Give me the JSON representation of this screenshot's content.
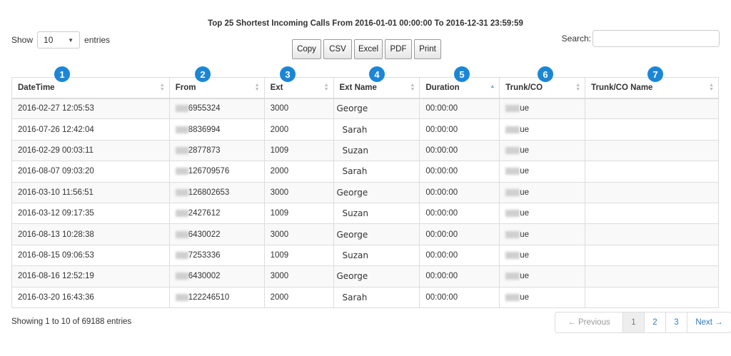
{
  "title": "Top 25 Shortest Incoming Calls From 2016-01-01 00:00:00 To 2016-12-31 23:59:59",
  "length": {
    "show_label": "Show",
    "value": "10",
    "entries_label": "entries"
  },
  "buttons": [
    "Copy",
    "CSV",
    "Excel",
    "PDF",
    "Print"
  ],
  "search": {
    "label": "Search:",
    "value": ""
  },
  "columns": [
    "DateTime",
    "From",
    "Ext",
    "Ext Name",
    "Duration",
    "Trunk/CO",
    "Trunk/CO Name"
  ],
  "badges": [
    "1",
    "2",
    "3",
    "4",
    "5",
    "6",
    "7"
  ],
  "rows": [
    {
      "datetime": "2016-02-27 12:05:53",
      "from": "6955324",
      "ext": "3000",
      "ext_name": "George",
      "duration": "00:00:00",
      "trunk": "ue",
      "trunk_name": ""
    },
    {
      "datetime": "2016-07-26 12:42:04",
      "from": "8836994",
      "ext": "2000",
      "ext_name": "Sarah",
      "duration": "00:00:00",
      "trunk": "ue",
      "trunk_name": ""
    },
    {
      "datetime": "2016-02-29 00:03:11",
      "from": "2877873",
      "ext": "1009",
      "ext_name": "Suzan",
      "duration": "00:00:00",
      "trunk": "ue",
      "trunk_name": ""
    },
    {
      "datetime": "2016-08-07 09:03:20",
      "from": "126709576",
      "ext": "2000",
      "ext_name": "Sarah",
      "duration": "00:00:00",
      "trunk": "ue",
      "trunk_name": ""
    },
    {
      "datetime": "2016-03-10 11:56:51",
      "from": "126802653",
      "ext": "3000",
      "ext_name": "George",
      "duration": "00:00:00",
      "trunk": "ue",
      "trunk_name": ""
    },
    {
      "datetime": "2016-03-12 09:17:35",
      "from": "2427612",
      "ext": "1009",
      "ext_name": "Suzan",
      "duration": "00:00:00",
      "trunk": "ue",
      "trunk_name": ""
    },
    {
      "datetime": "2016-08-13 10:28:38",
      "from": "6430022",
      "ext": "3000",
      "ext_name": "George",
      "duration": "00:00:00",
      "trunk": "ue",
      "trunk_name": ""
    },
    {
      "datetime": "2016-08-15 09:06:53",
      "from": "7253336",
      "ext": "1009",
      "ext_name": "Suzan",
      "duration": "00:00:00",
      "trunk": "ue",
      "trunk_name": ""
    },
    {
      "datetime": "2016-08-16 12:52:19",
      "from": "6430002",
      "ext": "3000",
      "ext_name": "George",
      "duration": "00:00:00",
      "trunk": "ue",
      "trunk_name": ""
    },
    {
      "datetime": "2016-03-20 16:43:36",
      "from": "122246510",
      "ext": "2000",
      "ext_name": "Sarah",
      "duration": "00:00:00",
      "trunk": "ue",
      "trunk_name": ""
    }
  ],
  "info": "Showing 1 to 10 of 69188 entries",
  "pagination": {
    "previous": "← Previous",
    "pages": [
      "1",
      "2",
      "3"
    ],
    "next": "Next →"
  },
  "colors": {
    "badge": "#1c86d6",
    "link": "#337ab7",
    "border": "#dddddd"
  }
}
